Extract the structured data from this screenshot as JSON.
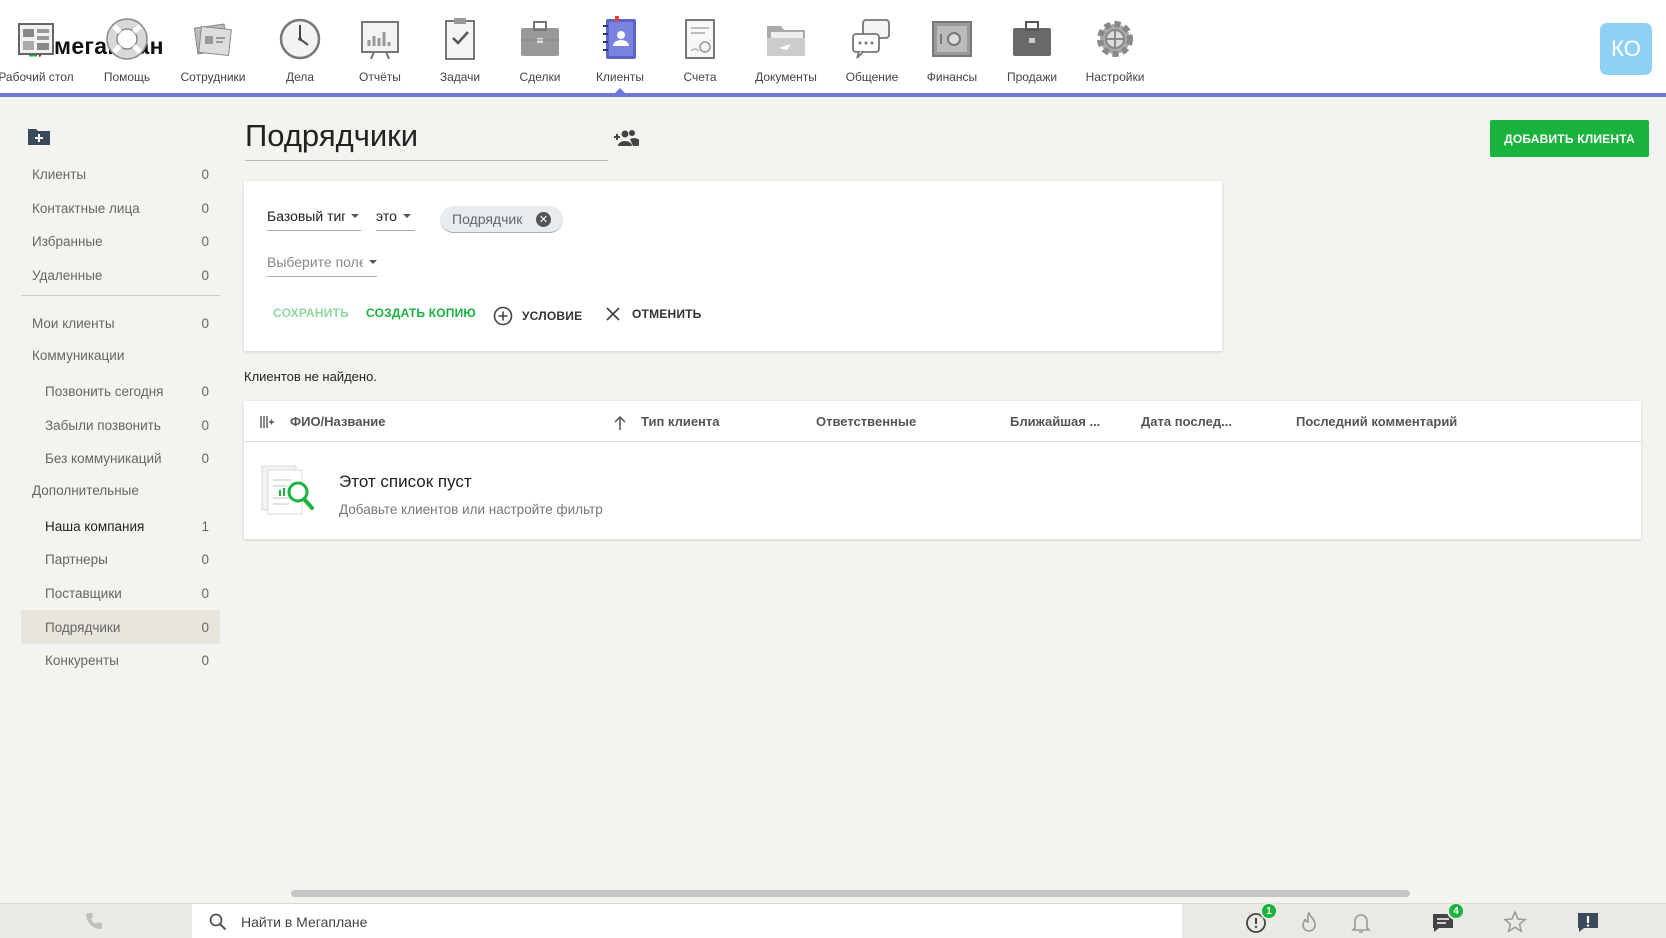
{
  "logo": {
    "text": "мегаплан"
  },
  "nav": [
    {
      "label": "Рабочий стол",
      "icon": "desktop-icon"
    },
    {
      "label": "Помощь",
      "icon": "lifebuoy-icon"
    },
    {
      "label": "Сотрудники",
      "icon": "employees-icon"
    },
    {
      "label": "Дела",
      "icon": "clock-icon"
    },
    {
      "label": "Отчёты",
      "icon": "report-icon"
    },
    {
      "label": "Задачи",
      "icon": "tasks-icon"
    },
    {
      "label": "Сделки",
      "icon": "briefcase-icon"
    },
    {
      "label": "Клиенты",
      "icon": "clients-book-icon",
      "active": true
    },
    {
      "label": "Счета",
      "icon": "invoice-icon"
    },
    {
      "label": "Документы",
      "icon": "folder-icon"
    },
    {
      "label": "Общение",
      "icon": "chat-icon"
    },
    {
      "label": "Финансы",
      "icon": "safe-icon"
    },
    {
      "label": "Продажи",
      "icon": "dark-briefcase-icon"
    },
    {
      "label": "Настройки",
      "icon": "gear-icon"
    }
  ],
  "user": {
    "initials": "КО"
  },
  "sidebar": {
    "top_items": [
      {
        "label": "Клиенты",
        "count": "0"
      },
      {
        "label": "Контактные лица",
        "count": "0"
      },
      {
        "label": "Избранные",
        "count": "0"
      },
      {
        "label": "Удаленные",
        "count": "0"
      }
    ],
    "my_clients": {
      "label": "Мои клиенты",
      "count": "0"
    },
    "communications": {
      "label": "Коммуникации",
      "items": [
        {
          "label": "Позвонить сегодня",
          "count": "0"
        },
        {
          "label": "Забыли позвонить",
          "count": "0"
        },
        {
          "label": "Без коммуникаций",
          "count": "0"
        }
      ]
    },
    "additional": {
      "label": "Дополнительные",
      "items": [
        {
          "label": "Наша компания",
          "count": "1"
        },
        {
          "label": "Партнеры",
          "count": "0"
        },
        {
          "label": "Поставщики",
          "count": "0"
        },
        {
          "label": "Подрядчики",
          "count": "0",
          "active": true
        },
        {
          "label": "Конкуренты",
          "count": "0"
        }
      ]
    }
  },
  "page": {
    "title": "Подрядчики",
    "add_button": "ДОБАВИТЬ КЛИЕНТА"
  },
  "filter": {
    "field": "Базовый тип",
    "operator": "это",
    "value_chip": "Подрядчик",
    "field_placeholder": "Выберите поле",
    "actions": {
      "save": "СОХРАНИТЬ",
      "copy": "СОЗДАТЬ КОПИЮ",
      "condition": "УСЛОВИЕ",
      "cancel": "ОТМЕНИТЬ"
    }
  },
  "result_text": "Клиентов не найдено.",
  "table": {
    "columns": [
      "ФИО/Название",
      "Тип клиента",
      "Ответственные",
      "Ближайшая ...",
      "Дата послед...",
      "Последний комментарий"
    ],
    "empty_title": "Этот список пуст",
    "empty_subtitle": "Добавьте клиентов или настройте фильтр"
  },
  "bottom": {
    "search_placeholder": "Найти в Мегаплане",
    "badges": {
      "alerts": "1",
      "messages": "4"
    }
  },
  "colors": {
    "accent": "#6f77d6",
    "green": "#19b33d",
    "avatar": "#8fd1f3"
  }
}
